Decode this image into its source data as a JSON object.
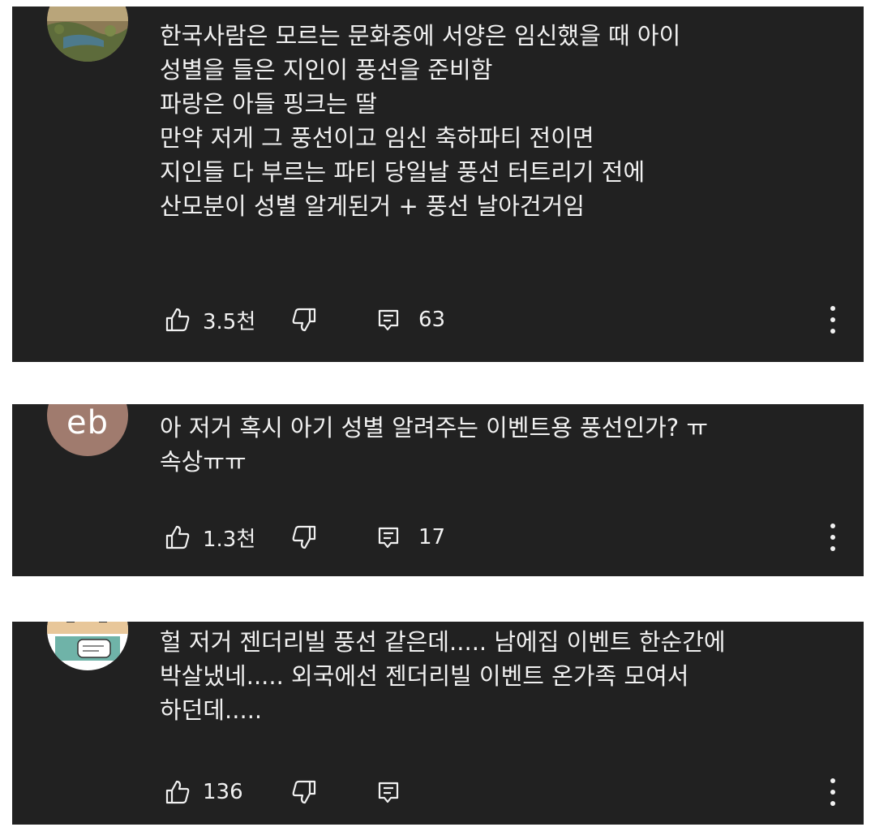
{
  "colors": {
    "card_background": "#212121",
    "text": "#f1f1f1",
    "avatar_eb_background": "#a07b6e"
  },
  "comments": [
    {
      "avatar": "landscape-photo-avatar",
      "lines": [
        "한국사람은 모르는 문화중에 서양은 임신했을 때 아이",
        "성별을 들은 지인이 풍선을 준비함",
        "파랑은 아들 핑크는 딸",
        "만약 저게 그 풍선이고 임신 축하파티 전이면",
        "지인들 다 부르는 파티 당일날 풍선 터트리기 전에",
        "산모분이 성별 알게된거 + 풍선 날아건거임"
      ],
      "likes": "3.5천",
      "replies": "63"
    },
    {
      "avatar": "eb",
      "lines": [
        "아 저거 혹시 아기 성별 알려주는 이벤트용 풍선인가? ㅠ",
        "속상ㅠㅠ"
      ],
      "likes": "1.3천",
      "replies": "17"
    },
    {
      "avatar": "cartoon-character-avatar",
      "lines": [
        "헐 저거 젠더리빌 풍선 같은데..... 남에집 이벤트 한순간에",
        "박살냈네..... 외국에선 젠더리빌 이벤트 온가족 모여서",
        "하던데....."
      ],
      "likes": "136",
      "replies": ""
    }
  ]
}
